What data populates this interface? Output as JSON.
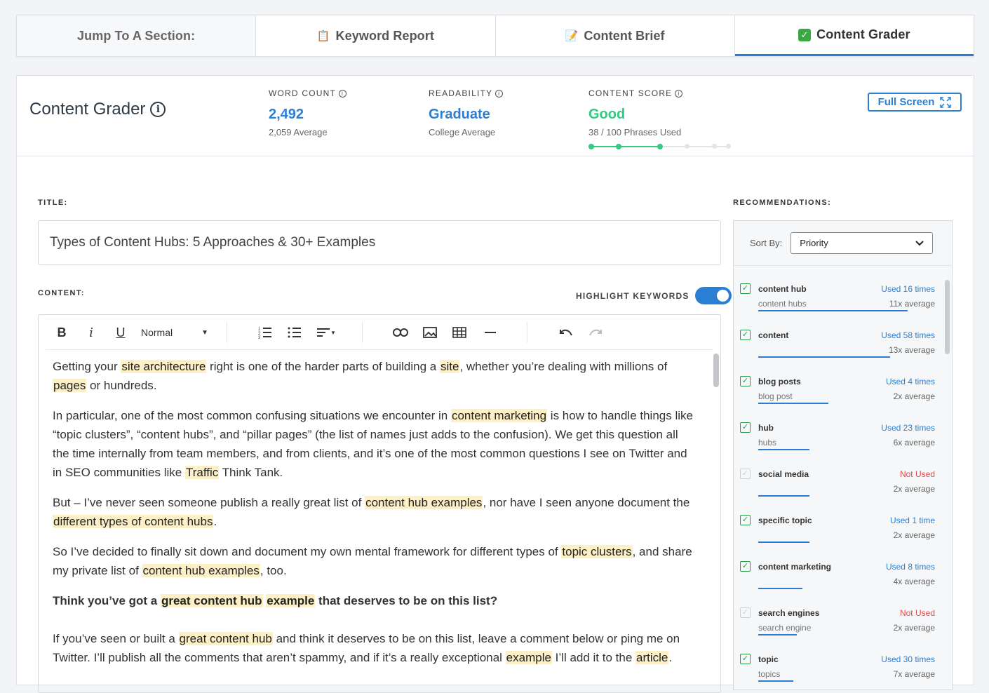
{
  "tabs": {
    "label": "Jump To A Section:",
    "items": [
      {
        "label": "Keyword Report",
        "icon": "clipboard-icon"
      },
      {
        "label": "Content Brief",
        "icon": "memo-icon"
      },
      {
        "label": "Content Grader",
        "icon": "check-mark-icon"
      }
    ]
  },
  "header": {
    "title": "Content Grader",
    "full_screen_label": "Full Screen",
    "word_count": {
      "label": "WORD COUNT",
      "value": "2,492",
      "sub": "2,059 Average"
    },
    "readability": {
      "label": "READABILITY",
      "value": "Graduate",
      "sub": "College Average"
    },
    "content_score": {
      "label": "CONTENT SCORE",
      "value": "Good",
      "sub": "38 / 100 Phrases Used",
      "level": 0.5
    }
  },
  "title_section": {
    "label": "TITLE:",
    "value": "Types of Content Hubs: 5 Approaches & 30+ Examples"
  },
  "content_section": {
    "label": "CONTENT:",
    "highlight_label": "HIGHLIGHT KEYWORDS",
    "highlight_on": true,
    "toolbar": {
      "format_select": "Normal"
    }
  },
  "recommendations": {
    "label": "RECOMMENDATIONS:",
    "sort_label": "Sort By:",
    "sort_value": "Priority",
    "items": [
      {
        "keyword": "content hub",
        "variant": "content hubs",
        "used": "Used 16 times",
        "average": "11x average",
        "checked": true,
        "fill": 0.85
      },
      {
        "keyword": "content",
        "variant": "",
        "used": "Used 58 times",
        "average": "13x average",
        "checked": true,
        "fill": 0.75
      },
      {
        "keyword": "blog posts",
        "variant": "blog post",
        "used": "Used 4 times",
        "average": "2x average",
        "checked": true,
        "fill": 0.4
      },
      {
        "keyword": "hub",
        "variant": "hubs",
        "used": "Used 23 times",
        "average": "6x average",
        "checked": true,
        "fill": 0.29
      },
      {
        "keyword": "social media",
        "variant": "",
        "used": "Not Used",
        "average": "2x average",
        "checked": false,
        "fill": 0.29
      },
      {
        "keyword": "specific topic",
        "variant": "",
        "used": "Used 1 time",
        "average": "2x average",
        "checked": true,
        "fill": 0.29
      },
      {
        "keyword": "content marketing",
        "variant": "",
        "used": "Used 8 times",
        "average": "4x average",
        "checked": true,
        "fill": 0.25
      },
      {
        "keyword": "search engines",
        "variant": "search engine",
        "used": "Not Used",
        "average": "2x average",
        "checked": false,
        "fill": 0.22
      },
      {
        "keyword": "topic",
        "variant": "topics",
        "used": "Used 30 times",
        "average": "7x average",
        "checked": true,
        "fill": 0.2
      }
    ]
  },
  "article": {
    "paragraphs": [
      [
        {
          "t": "Getting your "
        },
        {
          "t": "site architecture",
          "h": true
        },
        {
          "t": " right is one of the harder parts of building a "
        },
        {
          "t": "site",
          "h": true
        },
        {
          "t": ", whether you’re dealing with millions of "
        },
        {
          "t": "pages",
          "h": true
        },
        {
          "t": " or hundreds."
        }
      ],
      [
        {
          "t": "In particular, one of the most common confusing situations we encounter in "
        },
        {
          "t": "content marketing",
          "h": true
        },
        {
          "t": " is how to handle things like “topic clusters”, “content hubs”, and “pillar pages” (the list of names just adds to the confusion). We get this question all the time internally from team members, and from clients, and it’s one of the most common questions I see on Twitter and in SEO communities like "
        },
        {
          "t": "Traffic",
          "h": true
        },
        {
          "t": " Think Tank."
        }
      ],
      [
        {
          "t": "But – I’ve never seen someone publish a really great list of "
        },
        {
          "t": "content hub examples",
          "h": true
        },
        {
          "t": ", nor have I seen anyone document the "
        },
        {
          "t": "different types of content hubs",
          "h": true
        },
        {
          "t": "."
        }
      ],
      [
        {
          "t": "So I’ve decided to finally sit down and document my own mental framework for different types of "
        },
        {
          "t": "topic clusters",
          "h": true
        },
        {
          "t": ", and share my private list of "
        },
        {
          "t": "content hub examples",
          "h": true
        },
        {
          "t": ", too."
        }
      ],
      [
        {
          "t": "Think you’ve got a ",
          "b": true
        },
        {
          "t": "great content hub",
          "h": true,
          "b": true
        },
        {
          "t": " "
        },
        {
          "t": "example",
          "h": true,
          "b": true
        },
        {
          "t": " that deserves to be on this list?",
          "b": true
        }
      ],
      [
        {
          "t": "If you’ve seen or built a "
        },
        {
          "t": "great content hub",
          "h": true
        },
        {
          "t": " and think it deserves to be on this list, leave a comment below or ping me on Twitter. I’ll publish all the comments that aren’t spammy, and if it’s a really exceptional "
        },
        {
          "t": "example",
          "h": true
        },
        {
          "t": " I’ll add it to the "
        },
        {
          "t": "article",
          "h": true
        },
        {
          "t": "."
        }
      ]
    ]
  },
  "colors": {
    "accent": "#2a7fd4",
    "good": "#2ecb81",
    "highlight": "#fdf0c6",
    "not_used": "#e04a4a"
  }
}
